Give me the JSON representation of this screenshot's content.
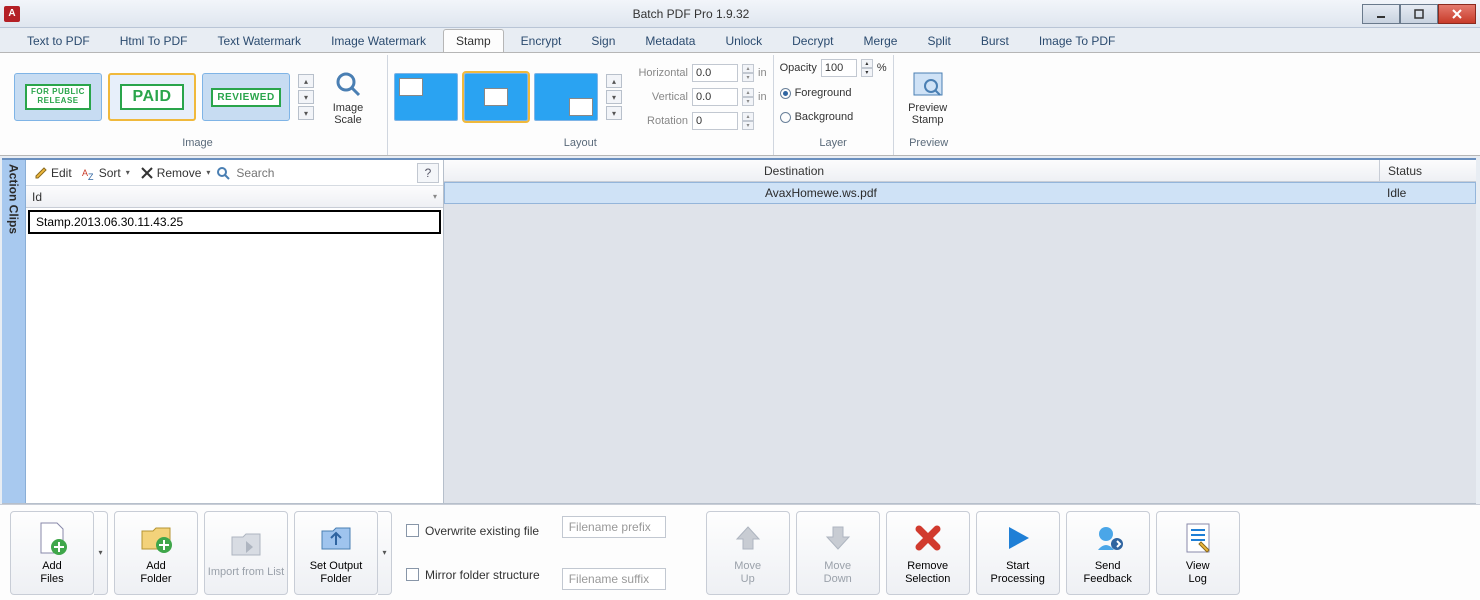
{
  "window": {
    "title": "Batch PDF Pro 1.9.32"
  },
  "tabs": [
    "Text to PDF",
    "Html To PDF",
    "Text Watermark",
    "Image Watermark",
    "Stamp",
    "Encrypt",
    "Sign",
    "Metadata",
    "Unlock",
    "Decrypt",
    "Merge",
    "Split",
    "Burst",
    "Image To PDF"
  ],
  "active_tab": "Stamp",
  "ribbon": {
    "image": {
      "label": "Image",
      "stamps": [
        "FOR PUBLIC\nRELEASE",
        "PAID",
        "REVIEWED"
      ],
      "scale_label": "Image\nScale",
      "scale_drop": "▾"
    },
    "layout": {
      "label": "Layout",
      "horizontal_label": "Horizontal",
      "horizontal_value": "0.0",
      "horizontal_unit": "in",
      "vertical_label": "Vertical",
      "vertical_value": "0.0",
      "vertical_unit": "in",
      "rotation_label": "Rotation",
      "rotation_value": "0"
    },
    "layer": {
      "label": "Layer",
      "opacity_label": "Opacity",
      "opacity_value": "100",
      "opacity_unit": "%",
      "foreground": "Foreground",
      "background": "Background"
    },
    "preview": {
      "label": "Preview",
      "btn": "Preview\nStamp"
    }
  },
  "sidebar_tab": "Action Clips",
  "left": {
    "edit": "Edit",
    "sort": "Sort",
    "remove": "Remove",
    "search_placeholder": "Search",
    "help": "?",
    "column_header": "Id",
    "items": [
      "Stamp.2013.06.30.11.43.25"
    ]
  },
  "right": {
    "columns": {
      "destination": "Destination",
      "status": "Status"
    },
    "rows": [
      {
        "destination": "AvaxHomewe.ws.pdf",
        "status": "Idle"
      }
    ]
  },
  "bottom": {
    "add_files": "Add\nFiles",
    "add_folder": "Add\nFolder",
    "import_list": "Import from List",
    "set_output": "Set Output\nFolder",
    "overwrite": "Overwrite existing file",
    "mirror": "Mirror folder structure",
    "prefix_placeholder": "Filename prefix",
    "suffix_placeholder": "Filename suffix",
    "move_up": "Move\nUp",
    "move_down": "Move\nDown",
    "remove_sel": "Remove\nSelection",
    "start": "Start\nProcessing",
    "feedback": "Send\nFeedback",
    "viewlog": "View\nLog"
  }
}
